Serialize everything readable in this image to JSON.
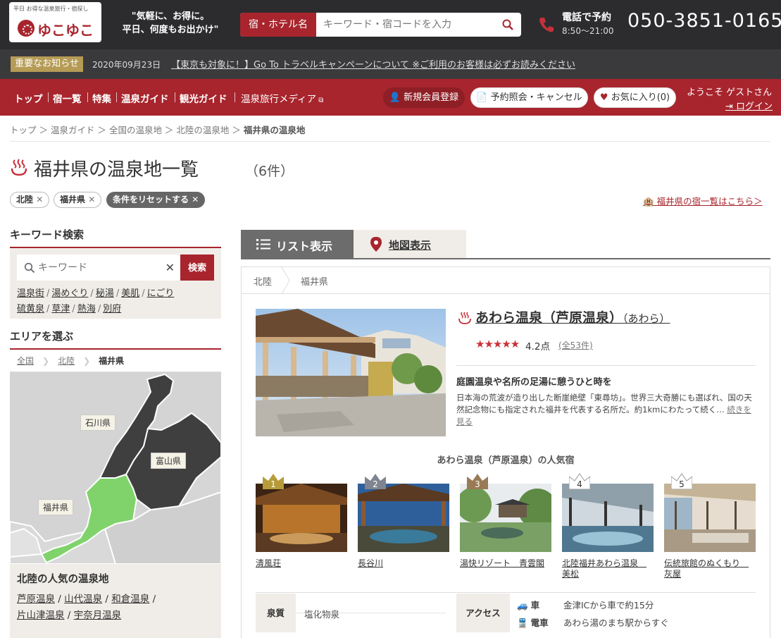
{
  "header": {
    "logo_tagline": "平日 お得な温泉旅行・宿探し",
    "logo_name": "ゆこゆこ",
    "catch_line1": "\"気軽に、お得に。",
    "catch_line2": "平日、何度もお出かけ\"",
    "search_category": "宿・ホテル名",
    "search_placeholder": "キーワード・宿コードを入力",
    "tel_label": "電話で予約",
    "tel_hours": "8:50〜21:00",
    "tel_number": "050-3851-0165"
  },
  "notice": {
    "badge": "重要なお知らせ",
    "date": "2020年09月23日",
    "text": "【東京も対象に！】Go To トラベルキャンペーンについて ※ご利用のお客様は必ずお読みください"
  },
  "nav": {
    "items": [
      "トップ",
      "宿一覧",
      "特集",
      "温泉ガイド",
      "観光ガイド",
      "温泉旅行メディア"
    ],
    "register": "新規会員登録",
    "reservation": "予約照会・キャンセル",
    "favorites": "お気に入り(0)",
    "welcome": "ようこそ ゲストさん",
    "login": "ログイン"
  },
  "breadcrumb": [
    "トップ",
    "温泉ガイド",
    "全国の温泉地",
    "北陸の温泉地",
    "福井県の温泉地"
  ],
  "page": {
    "title": "福井県の温泉地一覧",
    "count": "（6件）",
    "chips": [
      "北陸",
      "福井県",
      "条件をリセットする"
    ],
    "hotel_list_link": "福井県の宿一覧はこちら＞"
  },
  "sidebar": {
    "keyword_title": "キーワード検索",
    "keyword_placeholder": "キーワード",
    "keyword_button": "検索",
    "tags_row1": [
      "温泉街",
      "湯めぐり",
      "秘湯",
      "美肌",
      "にごり"
    ],
    "tags_row2": [
      "硫黄泉",
      "草津",
      "熱海",
      "別府"
    ],
    "area_title": "エリアを選ぶ",
    "area_crumb": [
      "全国",
      "北陸",
      "福井県"
    ],
    "map_labels": {
      "ishikawa": "石川県",
      "toyama": "富山県",
      "fukui": "福井県"
    },
    "popular_title": "北陸の人気の温泉地",
    "popular_row1": [
      "芦原温泉",
      "山代温泉",
      "和倉温泉"
    ],
    "popular_row2": [
      "片山津温泉",
      "宇奈月温泉"
    ]
  },
  "tabs": {
    "list": "リスト表示",
    "map": "地図表示"
  },
  "card": {
    "crumb": [
      "北陸",
      "福井県"
    ],
    "name": "あわら温泉（芦原温泉）",
    "reading": "（あわら）",
    "stars": "★★★★★",
    "rating": 4.2,
    "rating_text": "4.2点",
    "reviews": "(全53件)",
    "lead": "庭園温泉や名所の足湯に憩うひと時を",
    "description": "日本海の荒波が造り出した断崖絶壁「東尋坊」。世界三大奇勝にも選ばれ、国の天然記念物にも指定された福井を代表する名所だ。約1kmにわたって続く…",
    "more": "続きを見る",
    "popular_title": "あわら温泉（芦原温泉）の人気宿",
    "hotels": [
      {
        "rank": "1",
        "name": "清風荘"
      },
      {
        "rank": "2",
        "name": "長谷川"
      },
      {
        "rank": "3",
        "name": "湯快リゾート　青雲閣"
      },
      {
        "rank": "4",
        "name": "北陸福井あわら温泉　美松"
      },
      {
        "rank": "5",
        "name": "伝統旅館のぬくもり　灰屋"
      }
    ],
    "spring_label": "泉質",
    "spring_value": "塩化物泉",
    "access_label": "アクセス",
    "car_label": "車",
    "car_value": "金津ICから車で約15分",
    "train_label": "電車",
    "train_value": "あわら湯のまち駅からすぐ"
  },
  "colors": {
    "brand": "#a8252d",
    "header": "#2c2c2f",
    "gold": "#b59b55",
    "map_highlight": "#7fd36a"
  }
}
